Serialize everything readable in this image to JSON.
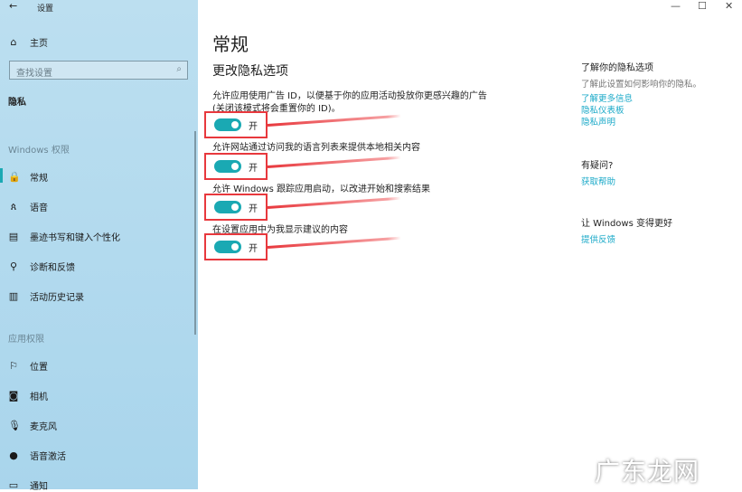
{
  "window": {
    "title": "设置",
    "back": "←",
    "minimize": "—",
    "maximize": "☐",
    "close": "✕"
  },
  "sidebar": {
    "home": "主页",
    "search_placeholder": "查找设置",
    "category": "隐私",
    "section1": "Windows 权限",
    "items1": [
      {
        "icon": "lock-icon",
        "glyph": "🔒",
        "label": "常规"
      },
      {
        "icon": "speech-icon",
        "glyph": "ጰ",
        "label": "语音"
      },
      {
        "icon": "clipboard-icon",
        "glyph": "▤",
        "label": "墨迹书写和键入个性化"
      },
      {
        "icon": "feedback-icon",
        "glyph": "⚲",
        "label": "诊断和反馈"
      },
      {
        "icon": "timeline-icon",
        "glyph": "▥",
        "label": "活动历史记录"
      }
    ],
    "section2": "应用权限",
    "items2": [
      {
        "icon": "location-icon",
        "glyph": "⚐",
        "label": "位置"
      },
      {
        "icon": "camera-icon",
        "glyph": "◙",
        "label": "相机"
      },
      {
        "icon": "microphone-icon",
        "glyph": "🎙",
        "label": "麦克风"
      },
      {
        "icon": "voice-activation-icon",
        "glyph": "●",
        "label": "语音激活"
      },
      {
        "icon": "notification-icon",
        "glyph": "▭",
        "label": "通知"
      }
    ]
  },
  "main": {
    "title": "常规",
    "subtitle": "更改隐私选项",
    "options": [
      {
        "text": "允许应用使用广告 ID，以便基于你的应用活动投放你更感兴趣的广告(关闭该模式将会重置你的 ID)。",
        "state": "开"
      },
      {
        "text": "允许网站通过访问我的语言列表来提供本地相关内容",
        "state": "开"
      },
      {
        "text": "允许 Windows 跟踪应用启动，以改进开始和搜索结果",
        "state": "开"
      },
      {
        "text": "在设置应用中为我显示建议的内容",
        "state": "开"
      }
    ]
  },
  "right": {
    "head1": "了解你的隐私选项",
    "text1": "了解此设置如何影响你的隐私。",
    "links1": [
      "了解更多信息",
      "隐私仪表板",
      "隐私声明"
    ],
    "head2": "有疑问?",
    "link2": "获取帮助",
    "head3": "让 Windows 变得更好",
    "link3": "提供反馈"
  },
  "watermark": "广东龙网",
  "colors": {
    "accent": "#1aa9b3",
    "highlight": "#e8383d",
    "sidebar": "#b3d9ec"
  }
}
